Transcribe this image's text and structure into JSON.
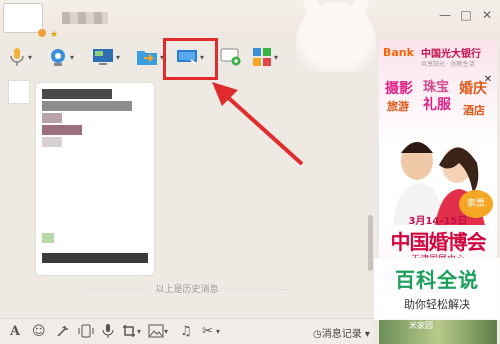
{
  "window": {
    "minimize_icon": "minimize-icon",
    "maximize_icon": "maximize-icon",
    "close_icon": "close-icon",
    "minimize_glyph": "—",
    "maximize_glyph": "□",
    "close_glyph": "✕"
  },
  "toolbar": {
    "items": [
      {
        "name": "voice-call",
        "icon": "microphone-icon"
      },
      {
        "name": "video-call",
        "icon": "webcam-icon"
      },
      {
        "name": "remote-desktop",
        "icon": "monitor-icon"
      },
      {
        "name": "send-file",
        "icon": "folder-icon"
      },
      {
        "name": "screen-share",
        "icon": "screen-share-icon",
        "highlighted": true
      },
      {
        "name": "create-discussion",
        "icon": "chat-add-icon"
      },
      {
        "name": "apps",
        "icon": "apps-grid-icon"
      }
    ],
    "caret_glyph": "▾",
    "highlight_color": "#e02c2c"
  },
  "chat": {
    "history_label": "以上是历史消息"
  },
  "bottombar": {
    "icons": [
      "font-icon",
      "emoji-icon",
      "magic-icon",
      "shake-icon",
      "voice-message-icon",
      "screenshot-icon",
      "image-icon",
      "music-icon",
      "scissors-icon"
    ],
    "glyphs": {
      "font": "A",
      "emoji": "☺",
      "music": "♫",
      "scissors": "✂"
    },
    "history_button": "◷消息记录 ▾"
  },
  "ad": {
    "bank_en": "Bank",
    "bank_cn": "中国光大银行",
    "bank_slogan": "共享阳光 · 创新生活",
    "close_glyph": "✕",
    "words": [
      "摄影",
      "珠宝",
      "婚庆",
      "旅游",
      "礼服",
      "酒店"
    ],
    "ticket": "索票",
    "date": "3月14-15日",
    "expo": "中国婚博会",
    "venue": "天津国展中心",
    "bottom_text": "米家园"
  },
  "watermark": {
    "title": "百科全说",
    "subtitle": "助你轻松解决"
  },
  "colors": {
    "accent_red": "#e02c2c",
    "ad_red": "#d2063e",
    "watermark_green": "#1aa05a"
  }
}
